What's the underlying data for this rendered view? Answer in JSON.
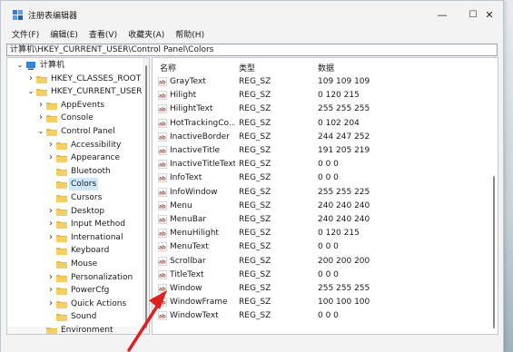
{
  "window": {
    "title": "注册表编辑器",
    "controls": {
      "minimize": "—",
      "maximize": "☐",
      "close": "✕"
    }
  },
  "menu": [
    "文件(F)",
    "编辑(E)",
    "查看(V)",
    "收藏夹(A)",
    "帮助(H)"
  ],
  "address": "计算机\\HKEY_CURRENT_USER\\Control Panel\\Colors",
  "tree": [
    {
      "label": "计算机",
      "level": 0,
      "chevron": "v",
      "icon": "computer-icon"
    },
    {
      "label": "HKEY_CLASSES_ROOT",
      "level": 1,
      "chevron": ">",
      "icon": "folder-icon"
    },
    {
      "label": "HKEY_CURRENT_USER",
      "level": 1,
      "chevron": "v",
      "icon": "folder-icon"
    },
    {
      "label": "AppEvents",
      "level": 2,
      "chevron": ">",
      "icon": "folder-icon"
    },
    {
      "label": "Console",
      "level": 2,
      "chevron": ">",
      "icon": "folder-icon"
    },
    {
      "label": "Control Panel",
      "level": 2,
      "chevron": "v",
      "icon": "folder-icon"
    },
    {
      "label": "Accessibility",
      "level": 3,
      "chevron": ">",
      "icon": "folder-icon"
    },
    {
      "label": "Appearance",
      "level": 3,
      "chevron": ">",
      "icon": "folder-icon"
    },
    {
      "label": "Bluetooth",
      "level": 3,
      "chevron": "",
      "icon": "folder-icon"
    },
    {
      "label": "Colors",
      "level": 3,
      "chevron": "",
      "icon": "folder-open-icon",
      "selected": true
    },
    {
      "label": "Cursors",
      "level": 3,
      "chevron": "",
      "icon": "folder-icon"
    },
    {
      "label": "Desktop",
      "level": 3,
      "chevron": ">",
      "icon": "folder-icon"
    },
    {
      "label": "Input Method",
      "level": 3,
      "chevron": ">",
      "icon": "folder-icon"
    },
    {
      "label": "International",
      "level": 3,
      "chevron": ">",
      "icon": "folder-icon"
    },
    {
      "label": "Keyboard",
      "level": 3,
      "chevron": "",
      "icon": "folder-icon"
    },
    {
      "label": "Mouse",
      "level": 3,
      "chevron": "",
      "icon": "folder-icon"
    },
    {
      "label": "Personalization",
      "level": 3,
      "chevron": ">",
      "icon": "folder-icon"
    },
    {
      "label": "PowerCfg",
      "level": 3,
      "chevron": ">",
      "icon": "folder-icon"
    },
    {
      "label": "Quick Actions",
      "level": 3,
      "chevron": ">",
      "icon": "folder-icon"
    },
    {
      "label": "Sound",
      "level": 3,
      "chevron": "",
      "icon": "folder-icon"
    },
    {
      "label": "Environment",
      "level": 2,
      "chevron": "",
      "icon": "folder-icon"
    }
  ],
  "columns": {
    "name": "名称",
    "type": "类型",
    "data": "数据"
  },
  "values": [
    {
      "name": "GrayText",
      "type": "REG_SZ",
      "data": "109 109 109"
    },
    {
      "name": "Hilight",
      "type": "REG_SZ",
      "data": "0 120 215"
    },
    {
      "name": "HilightText",
      "type": "REG_SZ",
      "data": "255 255 255"
    },
    {
      "name": "HotTrackingCo...",
      "type": "REG_SZ",
      "data": "0 102 204"
    },
    {
      "name": "InactiveBorder",
      "type": "REG_SZ",
      "data": "244 247 252"
    },
    {
      "name": "InactiveTitle",
      "type": "REG_SZ",
      "data": "191 205 219"
    },
    {
      "name": "InactiveTitleText",
      "type": "REG_SZ",
      "data": "0 0 0"
    },
    {
      "name": "InfoText",
      "type": "REG_SZ",
      "data": "0 0 0"
    },
    {
      "name": "InfoWindow",
      "type": "REG_SZ",
      "data": "255 255 225"
    },
    {
      "name": "Menu",
      "type": "REG_SZ",
      "data": "240 240 240"
    },
    {
      "name": "MenuBar",
      "type": "REG_SZ",
      "data": "240 240 240"
    },
    {
      "name": "MenuHilight",
      "type": "REG_SZ",
      "data": "0 120 215"
    },
    {
      "name": "MenuText",
      "type": "REG_SZ",
      "data": "0 0 0"
    },
    {
      "name": "Scrollbar",
      "type": "REG_SZ",
      "data": "200 200 200"
    },
    {
      "name": "TitleText",
      "type": "REG_SZ",
      "data": "0 0 0"
    },
    {
      "name": "Window",
      "type": "REG_SZ",
      "data": "255 255 255"
    },
    {
      "name": "WindowFrame",
      "type": "REG_SZ",
      "data": "100 100 100"
    },
    {
      "name": "WindowText",
      "type": "REG_SZ",
      "data": "0 0 0"
    }
  ],
  "colors": {
    "selection": "#cce8ff",
    "folder": "#e8b84a",
    "reg_icon": "#c0392b",
    "annotation_arrow": "#e02020"
  }
}
